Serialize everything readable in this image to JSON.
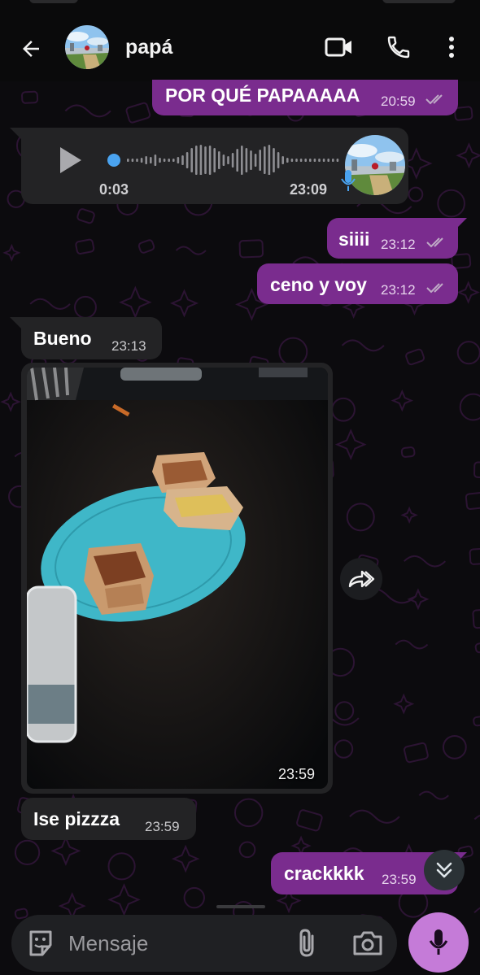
{
  "header": {
    "contact_name": "papá",
    "back_icon": "arrow-left-icon",
    "video_icon": "video-camera-icon",
    "call_icon": "phone-icon",
    "menu_icon": "more-vert-icon"
  },
  "colors": {
    "outgoing_bubble": "#7a2c8e",
    "incoming_bubble": "#232325",
    "mic_button": "#c57bd8",
    "voice_dot": "#4aa3f0"
  },
  "messages": [
    {
      "direction": "out",
      "text": "POR QUÉ PAPAAAAA",
      "time": "20:59",
      "status": "read"
    },
    {
      "direction": "in",
      "type": "voice",
      "duration": "0:03",
      "time": "23:09"
    },
    {
      "direction": "out",
      "text": "siiii",
      "time": "23:12",
      "status": "read"
    },
    {
      "direction": "out",
      "text": "ceno y voy",
      "time": "23:12",
      "status": "read"
    },
    {
      "direction": "in",
      "text": "Bueno",
      "time": "23:13"
    },
    {
      "direction": "in",
      "type": "image",
      "time": "23:59"
    },
    {
      "direction": "in",
      "text": "Ise pizzza",
      "time": "23:59"
    },
    {
      "direction": "out",
      "text": "crackkkk",
      "time": "23:59",
      "status": "read"
    }
  ],
  "composer": {
    "placeholder": "Mensaje",
    "emoji_icon": "sticker-icon",
    "attach_icon": "paperclip-icon",
    "camera_icon": "camera-icon",
    "mic_icon": "microphone-icon"
  }
}
